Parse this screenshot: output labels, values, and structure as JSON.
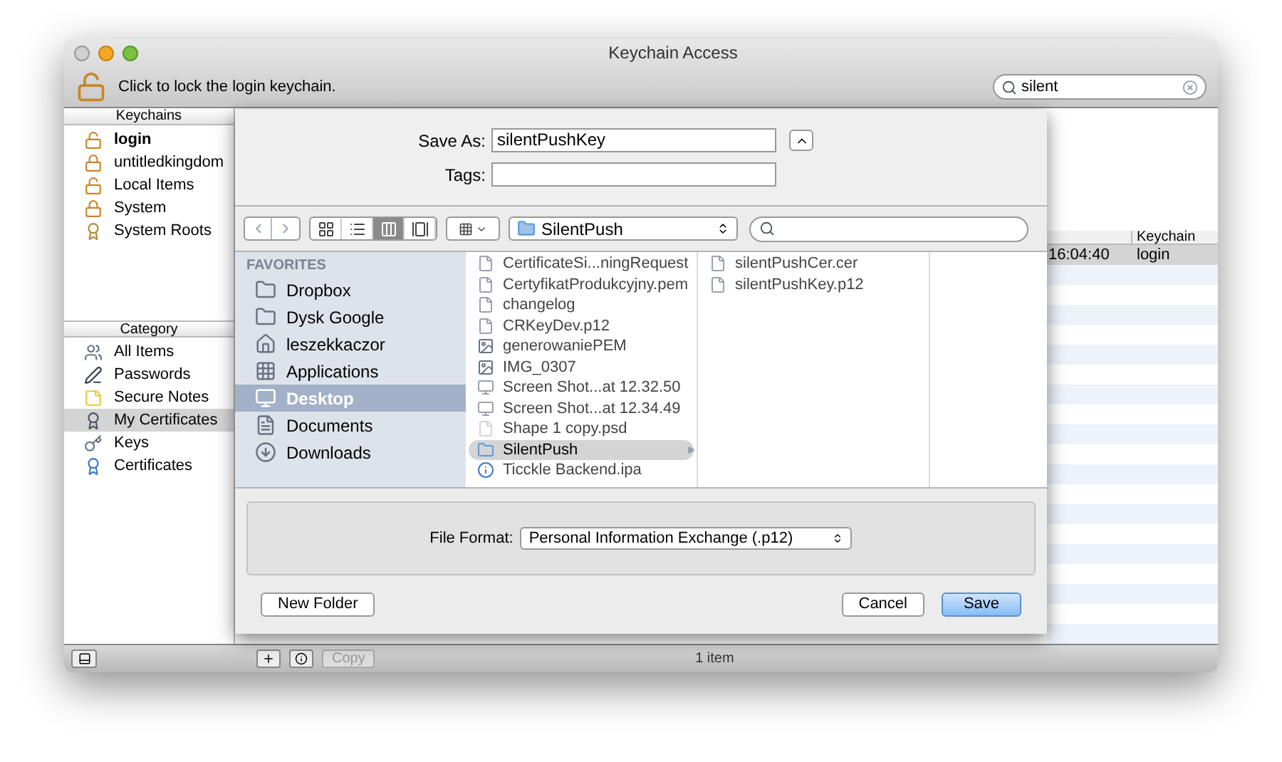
{
  "window": {
    "title": "Keychain Access"
  },
  "toolbar": {
    "lock_label": "Click to lock the login keychain.",
    "search": {
      "value": "silent"
    }
  },
  "keychains": {
    "heading": "Keychains",
    "items": [
      {
        "label": "login",
        "kind": "unlocked",
        "selected": true
      },
      {
        "label": "untitledkingdom",
        "kind": "locked",
        "selected": false
      },
      {
        "label": "Local Items",
        "kind": "unlocked",
        "selected": false
      },
      {
        "label": "System",
        "kind": "locked",
        "selected": false
      },
      {
        "label": "System Roots",
        "kind": "roots",
        "selected": false
      }
    ]
  },
  "category": {
    "heading": "Category",
    "items": [
      {
        "label": "All Items",
        "kind": "all",
        "selected": false
      },
      {
        "label": "Passwords",
        "kind": "password",
        "selected": false
      },
      {
        "label": "Secure Notes",
        "kind": "note",
        "selected": false
      },
      {
        "label": "My Certificates",
        "kind": "mycert",
        "selected": true
      },
      {
        "label": "Keys",
        "kind": "key",
        "selected": false
      },
      {
        "label": "Certificates",
        "kind": "cert",
        "selected": false
      }
    ]
  },
  "list": {
    "columns": [
      "Keychain"
    ],
    "rows": [
      {
        "column_1": "16:04:40",
        "keychain": "login",
        "selected": true
      }
    ]
  },
  "sheet": {
    "save_as": {
      "label": "Save As:",
      "value": "silentPushKey"
    },
    "tags": {
      "label": "Tags:"
    },
    "view_modes": [
      {
        "kind": "icons",
        "selected": false
      },
      {
        "kind": "list",
        "selected": false
      },
      {
        "kind": "columns",
        "selected": true
      },
      {
        "kind": "coverflow",
        "selected": false
      }
    ],
    "location": "SilentPush",
    "favorites_heading": "FAVORITES",
    "favorites": [
      {
        "label": "Dropbox",
        "kind": "folder",
        "selected": false
      },
      {
        "label": "Dysk Google",
        "kind": "folder",
        "selected": false
      },
      {
        "label": "leszekkaczor",
        "kind": "home",
        "selected": false
      },
      {
        "label": "Applications",
        "kind": "apps",
        "selected": false
      },
      {
        "label": "Desktop",
        "kind": "desktop",
        "selected": true
      },
      {
        "label": "Documents",
        "kind": "docs",
        "selected": false
      },
      {
        "label": "Downloads",
        "kind": "downloads",
        "selected": false
      }
    ],
    "columns": [
      [
        {
          "name": "CertificateSi...ningRequest",
          "kind": "file",
          "selected": false
        },
        {
          "name": "CertyfikatProdukcyjny.pem",
          "kind": "file",
          "selected": false
        },
        {
          "name": "changelog",
          "kind": "file",
          "selected": false
        },
        {
          "name": "CRKeyDev.p12",
          "kind": "file",
          "selected": false
        },
        {
          "name": "generowaniePEM",
          "kind": "image",
          "selected": false
        },
        {
          "name": "IMG_0307",
          "kind": "image",
          "selected": false
        },
        {
          "name": "Screen Shot...at 12.32.50",
          "kind": "screenshot",
          "selected": false
        },
        {
          "name": "Screen Shot...at 12.34.49",
          "kind": "screenshot",
          "selected": false
        },
        {
          "name": "Shape 1 copy.psd",
          "kind": "blank",
          "selected": false
        },
        {
          "name": "SilentPush",
          "kind": "folder",
          "selected": true
        },
        {
          "name": "Ticckle Backend.ipa",
          "kind": "app",
          "selected": false
        }
      ],
      [
        {
          "name": "silentPushCer.cer",
          "kind": "file",
          "selected": false
        },
        {
          "name": "silentPushKey.p12",
          "kind": "file",
          "selected": false
        }
      ]
    ],
    "file_format": {
      "label": "File Format:",
      "value": "Personal Information Exchange (.p12)"
    },
    "buttons": [
      {
        "label": "New Folder",
        "kind": "plain"
      },
      {
        "label": "Cancel",
        "kind": "plain"
      },
      {
        "label": "Save",
        "kind": "default"
      }
    ]
  },
  "status_bar": {
    "copy": {
      "label": "Copy",
      "disabled": true
    },
    "count": "1 item"
  }
}
